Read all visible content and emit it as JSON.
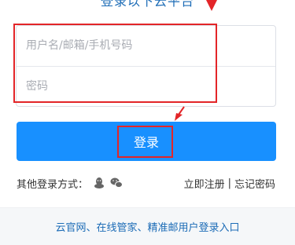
{
  "header": {
    "title_fragment": "登录以下云平台"
  },
  "form": {
    "username_placeholder": "用户名/邮箱/手机号码",
    "password_placeholder": "密码",
    "login_label": "登录"
  },
  "other_login": {
    "label": "其他登录方式：",
    "icons": [
      "qq-icon",
      "wechat-icon"
    ]
  },
  "links": {
    "register": "立即注册",
    "separator": "|",
    "forgot": "忘记密码"
  },
  "footer": {
    "link_text": "云官网、在线管家、精准邮用户登录入口"
  },
  "colors": {
    "accent": "#1890ff",
    "highlight": "#e32528",
    "link": "#1b6bb6"
  }
}
